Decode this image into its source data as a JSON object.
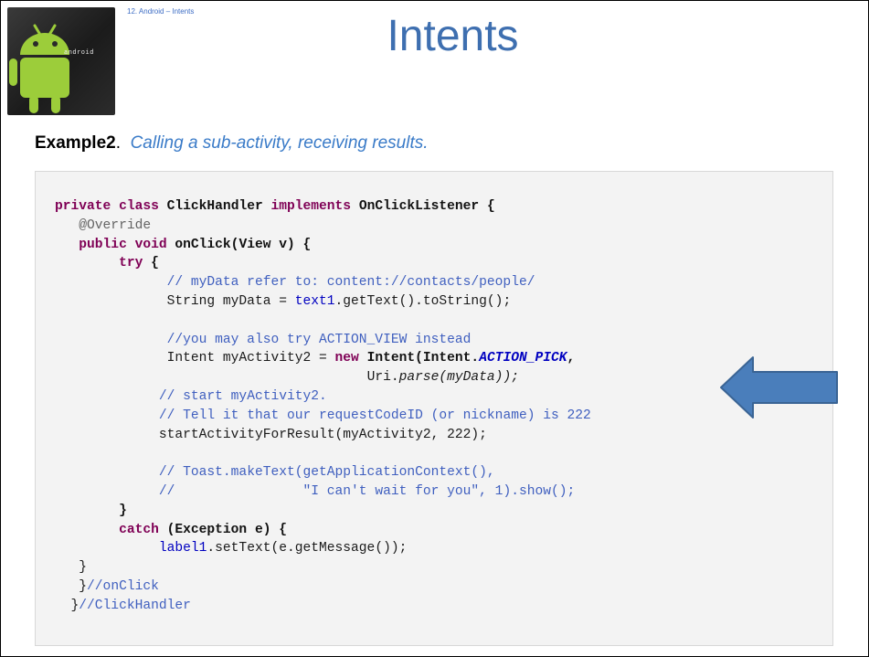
{
  "header": {
    "breadcrumb": "12. Android – Intents",
    "title": "Intents",
    "logo_text": "android"
  },
  "example": {
    "label": "Example2",
    "separator": ".",
    "description": "Calling a sub-activity, receiving results."
  },
  "code": {
    "line1": {
      "a": "private",
      "b": " ",
      "c": "class",
      "d": " ClickHandler ",
      "e": "implements",
      "f": " OnClickListener {"
    },
    "line2": {
      "a": "@Override"
    },
    "line3": {
      "a": "public",
      "b": " ",
      "c": "void",
      "d": " onClick(View v) {"
    },
    "line4": {
      "a": "try",
      "b": " {"
    },
    "line5": {
      "a": "// myData refer to: content://contacts/people/"
    },
    "line6": {
      "a": "String myData = ",
      "b": "text1",
      "c": ".getText().toString();"
    },
    "line8": {
      "a": "//you may also try ACTION_VIEW instead"
    },
    "line9": {
      "a": "Intent myActivity2 = ",
      "b": "new",
      "c": " Intent(Intent.",
      "d": "ACTION_PICK",
      "e": ","
    },
    "line10": {
      "a": "Uri.",
      "b": "parse(myData));"
    },
    "line11": {
      "a": "// start myActivity2."
    },
    "line12": {
      "a": "// Tell it that our requestCodeID (or nickname) is 222"
    },
    "line13": {
      "a": "startActivityForResult(myActivity2, 222);"
    },
    "line15": {
      "a": "// Toast.makeText(getApplicationContext(),"
    },
    "line16": {
      "a": "//",
      "b": "\"I can't wait for you\", 1).show();"
    },
    "line17": {
      "a": "}"
    },
    "line18": {
      "a": "catch",
      "b": " (Exception e) {"
    },
    "line19": {
      "a": "label1",
      "b": ".setText(e.getMessage());"
    },
    "line20": {
      "a": "}"
    },
    "line21": {
      "a": "}",
      "b": "//onClick"
    },
    "line22": {
      "a": "}",
      "b": "//ClickHandler"
    }
  },
  "colors": {
    "title": "#3e6fb0",
    "arrow_fill": "#4a7ebb",
    "arrow_stroke": "#3a6494"
  },
  "icons": {
    "logo": "android-robot-logo",
    "arrow": "left-pointing-arrow-icon"
  }
}
